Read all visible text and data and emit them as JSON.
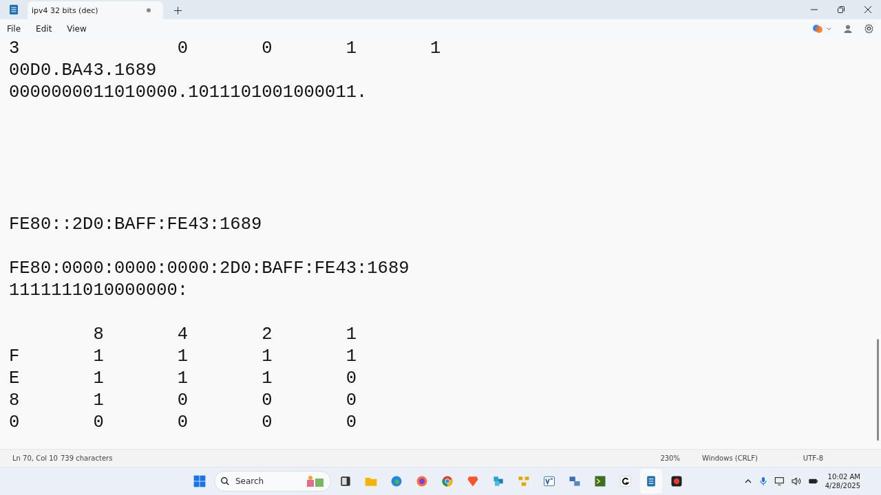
{
  "window": {
    "tab_title": "ipv4  32 bits (dec)",
    "tab_unsaved": true
  },
  "menu": [
    "File",
    "Edit",
    "View"
  ],
  "document": {
    "text": "3\t\t0\t0\t1\t1\n00D0.BA43.1689\n0000000011010000.1011101001000011.\n\n\n\n\n\nFE80::2D0:BAFF:FE43:1689\n\nFE80:0000:0000:0000:2D0:BAFF:FE43:1689\n1111111010000000:\n\n\t8\t4\t2\t1\nF\t1\t1\t1\t1\nE\t1\t1\t1\t0\n8\t1\t0\t0\t0\n0\t0\t0\t0\t0"
  },
  "status_bar": {
    "position": "Ln 70, Col 10",
    "characters": "739 characters",
    "zoom": "230%",
    "line_endings": "Windows (CRLF)",
    "encoding": "UTF-8"
  },
  "taskbar": {
    "search_placeholder": "Search",
    "time": "10:02 AM",
    "date": "4/28/2025"
  }
}
